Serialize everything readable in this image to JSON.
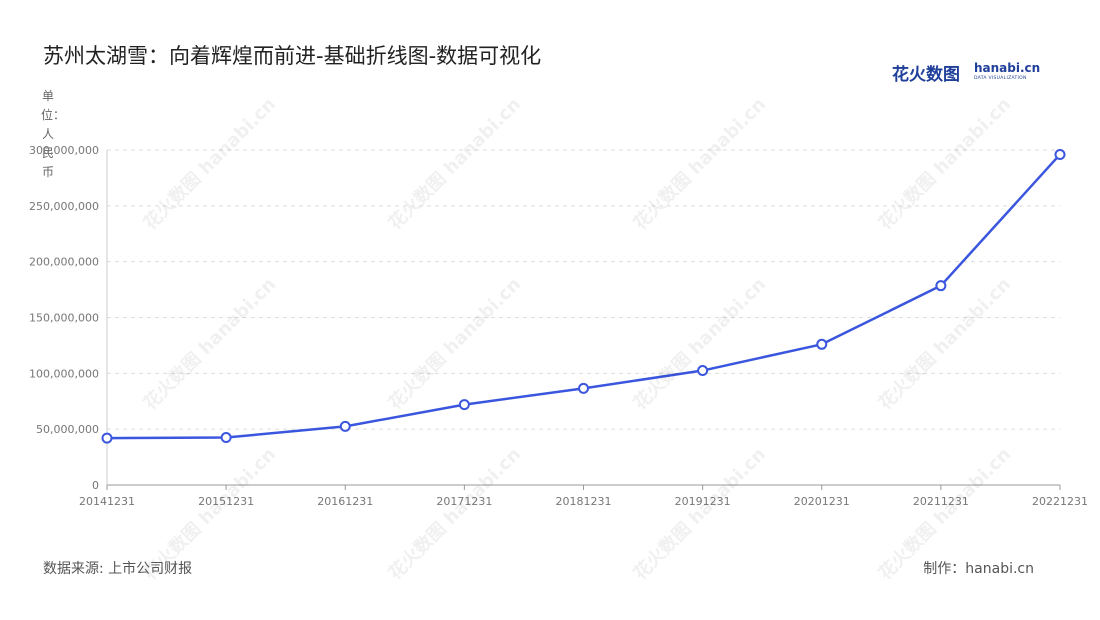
{
  "header": {
    "title": "苏州太湖雪：向着辉煌而前进-基础折线图-数据可视化"
  },
  "logo": {
    "cn": "花火数图",
    "en": "hanabi.cn",
    "sub": "DATA VISUALIZATION"
  },
  "footer": {
    "source": "数据来源: 上市公司财报",
    "maker": "制作：hanabi.cn"
  },
  "colors": {
    "line": "#3b56de",
    "grid": "#dddddd",
    "axis": "#999999"
  },
  "chart_data": {
    "type": "line",
    "title": "苏州太湖雪：向着辉煌而前进-基础折线图-数据可视化",
    "ylabel": "单位：人民币",
    "xlabel": "",
    "x": [
      "20141231",
      "20151231",
      "20161231",
      "20171231",
      "20181231",
      "20191231",
      "20201231",
      "20211231",
      "20221231"
    ],
    "series": [
      {
        "values": [
          42000000,
          42500000,
          52500000,
          72000000,
          86500000,
          102500000,
          126000000,
          178500000,
          296000000
        ]
      }
    ],
    "ylim": [
      0,
      300000000
    ],
    "yticks": [
      0,
      50000000,
      100000000,
      150000000,
      200000000,
      250000000,
      300000000
    ],
    "ytick_labels": [
      "0",
      "50,000,000",
      "100,000,000",
      "150,000,000",
      "200,000,000",
      "250,000,000",
      "300,000,000"
    ],
    "grid": true,
    "legend": "none"
  }
}
